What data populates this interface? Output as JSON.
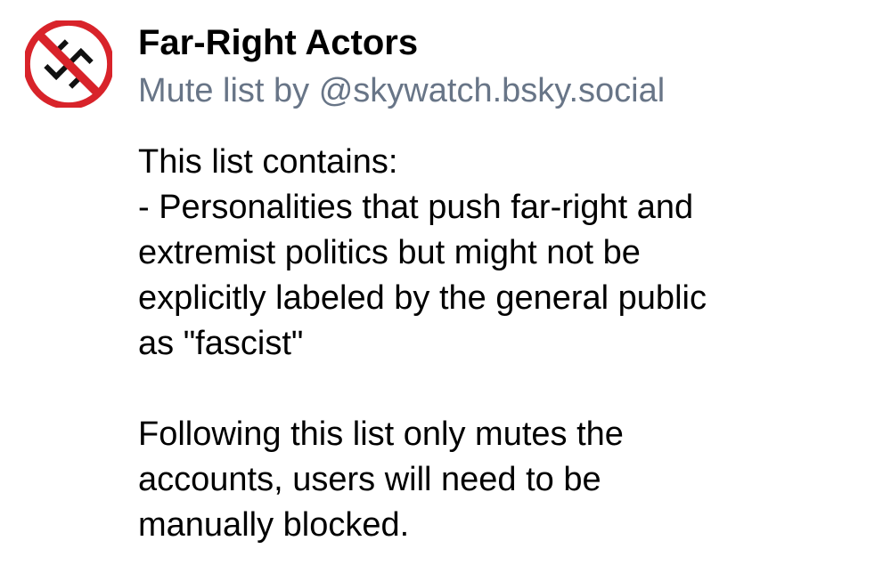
{
  "list": {
    "title": "Far-Right Actors",
    "subtitle": "Mute list by @skywatch.bsky.social",
    "avatar_icon": "prohibited-swastika-icon",
    "description_lines": [
      "This list contains:",
      "- Personalities that push far-right and",
      "extremist politics but might not be",
      "explicitly labeled by the general public",
      "as \"fascist\"",
      "",
      "Following this list only mutes the",
      "accounts, users will need to be",
      "manually blocked."
    ]
  },
  "colors": {
    "prohibition_red": "#d8232a",
    "subtitle_gray": "#687587",
    "text": "#000000"
  }
}
